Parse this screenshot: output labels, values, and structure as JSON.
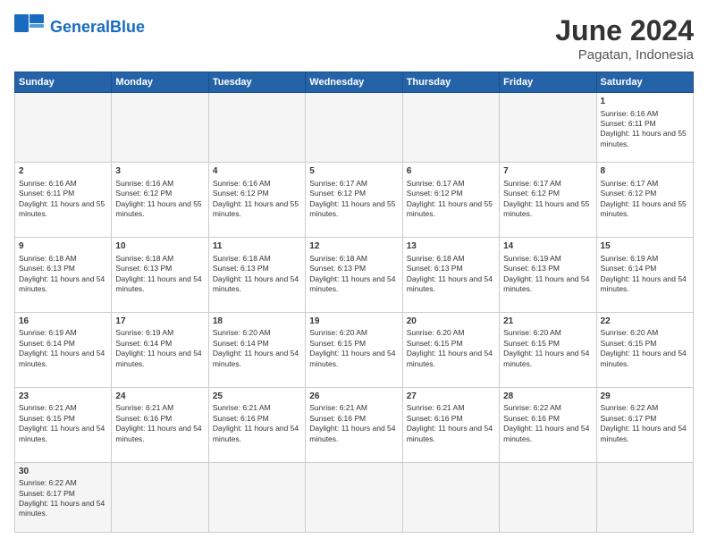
{
  "header": {
    "logo_general": "General",
    "logo_blue": "Blue",
    "month_title": "June 2024",
    "location": "Pagatan, Indonesia"
  },
  "days_of_week": [
    "Sunday",
    "Monday",
    "Tuesday",
    "Wednesday",
    "Thursday",
    "Friday",
    "Saturday"
  ],
  "weeks": [
    [
      {
        "day": "",
        "empty": true
      },
      {
        "day": "",
        "empty": true
      },
      {
        "day": "",
        "empty": true
      },
      {
        "day": "",
        "empty": true
      },
      {
        "day": "",
        "empty": true
      },
      {
        "day": "",
        "empty": true
      },
      {
        "day": "1",
        "sunrise": "6:16 AM",
        "sunset": "6:11 PM",
        "daylight": "11 hours and 55 minutes."
      }
    ],
    [
      {
        "day": "2",
        "sunrise": "6:16 AM",
        "sunset": "6:11 PM",
        "daylight": "11 hours and 55 minutes."
      },
      {
        "day": "3",
        "sunrise": "6:16 AM",
        "sunset": "6:12 PM",
        "daylight": "11 hours and 55 minutes."
      },
      {
        "day": "4",
        "sunrise": "6:16 AM",
        "sunset": "6:12 PM",
        "daylight": "11 hours and 55 minutes."
      },
      {
        "day": "5",
        "sunrise": "6:17 AM",
        "sunset": "6:12 PM",
        "daylight": "11 hours and 55 minutes."
      },
      {
        "day": "6",
        "sunrise": "6:17 AM",
        "sunset": "6:12 PM",
        "daylight": "11 hours and 55 minutes."
      },
      {
        "day": "7",
        "sunrise": "6:17 AM",
        "sunset": "6:12 PM",
        "daylight": "11 hours and 55 minutes."
      },
      {
        "day": "8",
        "sunrise": "6:17 AM",
        "sunset": "6:12 PM",
        "daylight": "11 hours and 55 minutes."
      }
    ],
    [
      {
        "day": "9",
        "sunrise": "6:18 AM",
        "sunset": "6:13 PM",
        "daylight": "11 hours and 54 minutes."
      },
      {
        "day": "10",
        "sunrise": "6:18 AM",
        "sunset": "6:13 PM",
        "daylight": "11 hours and 54 minutes."
      },
      {
        "day": "11",
        "sunrise": "6:18 AM",
        "sunset": "6:13 PM",
        "daylight": "11 hours and 54 minutes."
      },
      {
        "day": "12",
        "sunrise": "6:18 AM",
        "sunset": "6:13 PM",
        "daylight": "11 hours and 54 minutes."
      },
      {
        "day": "13",
        "sunrise": "6:18 AM",
        "sunset": "6:13 PM",
        "daylight": "11 hours and 54 minutes."
      },
      {
        "day": "14",
        "sunrise": "6:19 AM",
        "sunset": "6:13 PM",
        "daylight": "11 hours and 54 minutes."
      },
      {
        "day": "15",
        "sunrise": "6:19 AM",
        "sunset": "6:14 PM",
        "daylight": "11 hours and 54 minutes."
      }
    ],
    [
      {
        "day": "16",
        "sunrise": "6:19 AM",
        "sunset": "6:14 PM",
        "daylight": "11 hours and 54 minutes."
      },
      {
        "day": "17",
        "sunrise": "6:19 AM",
        "sunset": "6:14 PM",
        "daylight": "11 hours and 54 minutes."
      },
      {
        "day": "18",
        "sunrise": "6:20 AM",
        "sunset": "6:14 PM",
        "daylight": "11 hours and 54 minutes."
      },
      {
        "day": "19",
        "sunrise": "6:20 AM",
        "sunset": "6:15 PM",
        "daylight": "11 hours and 54 minutes."
      },
      {
        "day": "20",
        "sunrise": "6:20 AM",
        "sunset": "6:15 PM",
        "daylight": "11 hours and 54 minutes."
      },
      {
        "day": "21",
        "sunrise": "6:20 AM",
        "sunset": "6:15 PM",
        "daylight": "11 hours and 54 minutes."
      },
      {
        "day": "22",
        "sunrise": "6:20 AM",
        "sunset": "6:15 PM",
        "daylight": "11 hours and 54 minutes."
      }
    ],
    [
      {
        "day": "23",
        "sunrise": "6:21 AM",
        "sunset": "6:15 PM",
        "daylight": "11 hours and 54 minutes."
      },
      {
        "day": "24",
        "sunrise": "6:21 AM",
        "sunset": "6:16 PM",
        "daylight": "11 hours and 54 minutes."
      },
      {
        "day": "25",
        "sunrise": "6:21 AM",
        "sunset": "6:16 PM",
        "daylight": "11 hours and 54 minutes."
      },
      {
        "day": "26",
        "sunrise": "6:21 AM",
        "sunset": "6:16 PM",
        "daylight": "11 hours and 54 minutes."
      },
      {
        "day": "27",
        "sunrise": "6:21 AM",
        "sunset": "6:16 PM",
        "daylight": "11 hours and 54 minutes."
      },
      {
        "day": "28",
        "sunrise": "6:22 AM",
        "sunset": "6:16 PM",
        "daylight": "11 hours and 54 minutes."
      },
      {
        "day": "29",
        "sunrise": "6:22 AM",
        "sunset": "6:17 PM",
        "daylight": "11 hours and 54 minutes."
      }
    ],
    [
      {
        "day": "30",
        "sunrise": "6:22 AM",
        "sunset": "6:17 PM",
        "daylight": "11 hours and 54 minutes."
      },
      {
        "day": "",
        "empty": true
      },
      {
        "day": "",
        "empty": true
      },
      {
        "day": "",
        "empty": true
      },
      {
        "day": "",
        "empty": true
      },
      {
        "day": "",
        "empty": true
      },
      {
        "day": "",
        "empty": true
      }
    ]
  ],
  "labels": {
    "sunrise": "Sunrise:",
    "sunset": "Sunset:",
    "daylight": "Daylight:"
  }
}
